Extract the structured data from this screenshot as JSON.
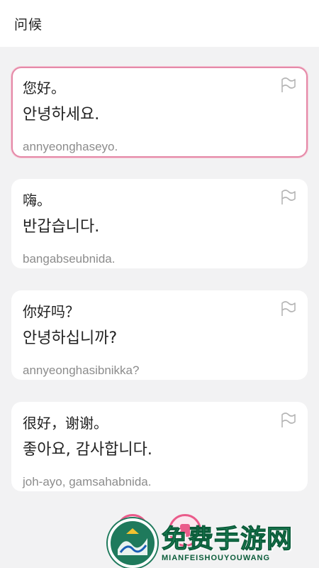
{
  "header": {
    "title": "问候"
  },
  "cards": [
    {
      "zh": "您好。",
      "ko": "안녕하세요.",
      "rom": "annyeonghaseyo.",
      "selected": true
    },
    {
      "zh": "嗨。",
      "ko": "반갑습니다.",
      "rom": "bangabseubnida.",
      "selected": false
    },
    {
      "zh": "你好吗？",
      "ko": "안녕하십니까?",
      "rom": "annyeonghasibnikka?",
      "selected": false
    },
    {
      "zh": "很好，谢谢。",
      "ko": "좋아요, 감사합니다.",
      "rom": "joh-ayo, gamsahabnida.",
      "selected": false
    }
  ],
  "icons": {
    "flag": "flag-outline-icon",
    "record": "record-button-icon",
    "play": "play-button-icon"
  },
  "watermark": {
    "title": "免费手游网",
    "subtitle": "MIANFEISHOUYOUWANG"
  },
  "colors": {
    "accent": "#e58aa8",
    "record": "#ea5b8a",
    "watermark_green": "#2aa36b"
  }
}
